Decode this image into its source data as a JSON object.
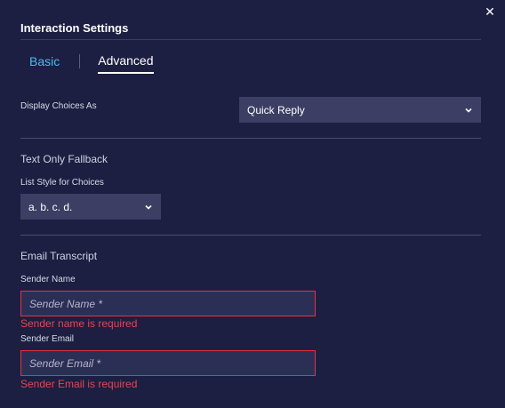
{
  "dialog": {
    "title": "Interaction Settings",
    "close_glyph": "✕",
    "close_icon": "close-icon"
  },
  "tabs": [
    {
      "label": "Basic",
      "active": false
    },
    {
      "label": "Advanced",
      "active": true
    }
  ],
  "display_choices": {
    "label": "Display Choices As",
    "value": "Quick Reply"
  },
  "text_only_fallback": {
    "heading": "Text Only Fallback",
    "list_style_label": "List Style for Choices",
    "list_style_value": "a. b. c. d."
  },
  "email_transcript": {
    "heading": "Email Transcript",
    "sender_name_label": "Sender Name",
    "sender_name_placeholder": "Sender Name *",
    "sender_name_error": "Sender name is required",
    "sender_email_label": "Sender Email",
    "sender_email_placeholder": "Sender Email *",
    "sender_email_error": "Sender Email is required"
  },
  "colors": {
    "background": "#1c1f41",
    "accent": "#4fb8f2",
    "error": "#e8444f",
    "select_bg": "#3c3f63"
  }
}
